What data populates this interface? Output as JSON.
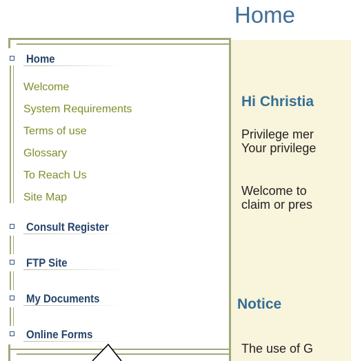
{
  "page": {
    "title": "Home"
  },
  "sidebar": {
    "sections": [
      {
        "label": "Home"
      },
      {
        "label": "Consult Register"
      },
      {
        "label": "FTP Site"
      },
      {
        "label": "My Documents"
      },
      {
        "label": "Online Forms"
      }
    ],
    "home_items": [
      {
        "label": "Welcome"
      },
      {
        "label": "System Requirements"
      },
      {
        "label": "Terms of use"
      },
      {
        "label": "Glossary"
      },
      {
        "label": "To Reach Us"
      },
      {
        "label": "Site Map"
      }
    ]
  },
  "main": {
    "greeting": "Hi Christia",
    "privilege_line1": "Privilege mer",
    "privilege_line2": "Your privilege",
    "welcome_line1": "Welcome to",
    "welcome_line2": "claim or pres",
    "notice_heading": "Notice",
    "notice_text": "The use of G"
  },
  "colors": {
    "accent": "#3f6e96",
    "nav_link": "#7c8f2a",
    "section_label": "#25446b",
    "frame": "#a2a87a",
    "content_bg": "#f9f4dc"
  }
}
